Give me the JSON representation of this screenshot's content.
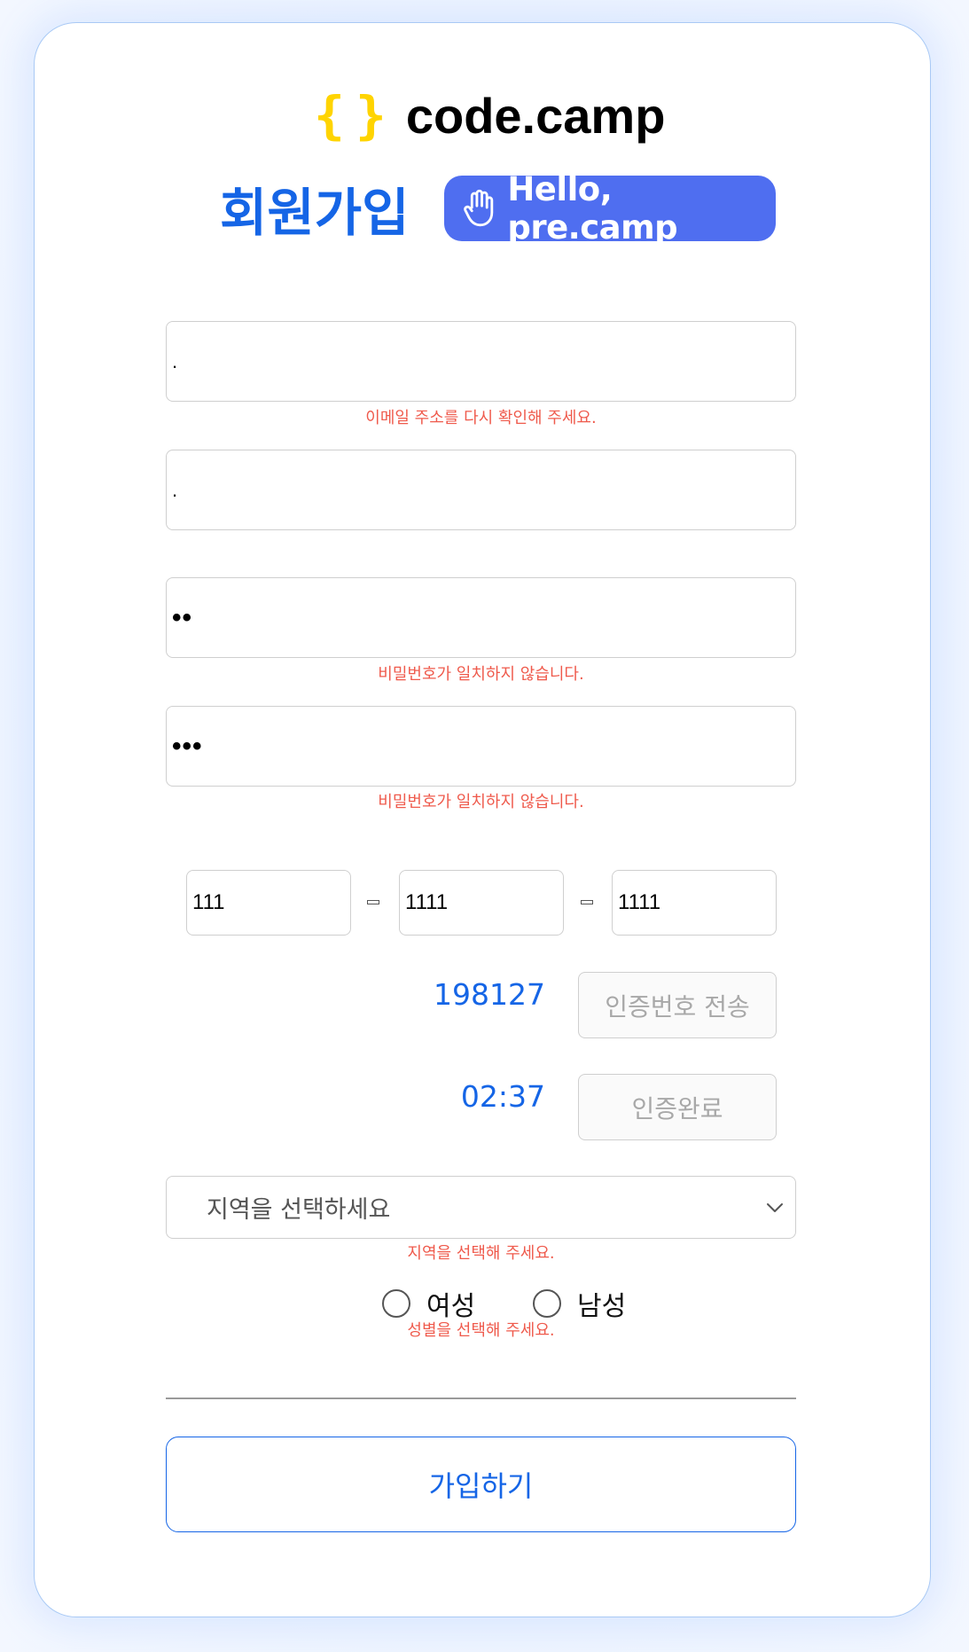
{
  "brand": {
    "brace_open": "{",
    "brace_close": "}",
    "name": "code.camp"
  },
  "title": "회원가입",
  "badge": {
    "text": "Hello, pre.camp",
    "icon": "hand-icon"
  },
  "form": {
    "email": {
      "value": ".",
      "error": "이메일 주소를 다시 확인해 주세요."
    },
    "name": {
      "value": "."
    },
    "password": {
      "value": "••",
      "error": "비밀번호가 일치하지 않습니다."
    },
    "password_confirm": {
      "value": "•••",
      "error": "비밀번호가 일치하지 않습니다."
    },
    "phone": [
      "111",
      "1111",
      "1111"
    ],
    "verification_code": "198127",
    "send_code_label": "인증번호 전송",
    "timer": "02:37",
    "verify_label": "인증완료",
    "region": {
      "selected": "지역을 선택하세요",
      "error": "지역을 선택해 주세요."
    },
    "gender": {
      "options": [
        "여성",
        "남성"
      ],
      "error": "성별을 선택해 주세요."
    },
    "submit_label": "가입하기"
  },
  "colors": {
    "accent": "#1565e6",
    "badge": "#4f6ef0",
    "logo_brace": "#ffd400",
    "error": "#ef5a4c"
  }
}
